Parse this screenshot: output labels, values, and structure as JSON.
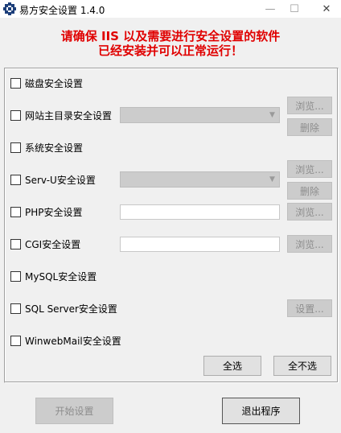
{
  "window": {
    "title": "易方安全设置 1.4.0"
  },
  "warning": {
    "line1": "请确保 IIS 以及需要进行安全设置的软件",
    "line2": "已经安装并可以正常运行！"
  },
  "options": [
    {
      "label": "磁盘安全设置"
    },
    {
      "label": "网站主目录安全设置"
    },
    {
      "label": "系统安全设置"
    },
    {
      "label": "Serv-U安全设置"
    },
    {
      "label": "PHP安全设置"
    },
    {
      "label": "CGI安全设置"
    },
    {
      "label": "MySQL安全设置"
    },
    {
      "label": "SQL Server安全设置"
    },
    {
      "label": "WinwebMail安全设置"
    }
  ],
  "buttons": {
    "browse": "浏览...",
    "delete": "删除",
    "settings": "设置...",
    "select_all": "全选",
    "select_none": "全不选",
    "start": "开始设置",
    "exit": "退出程序"
  }
}
